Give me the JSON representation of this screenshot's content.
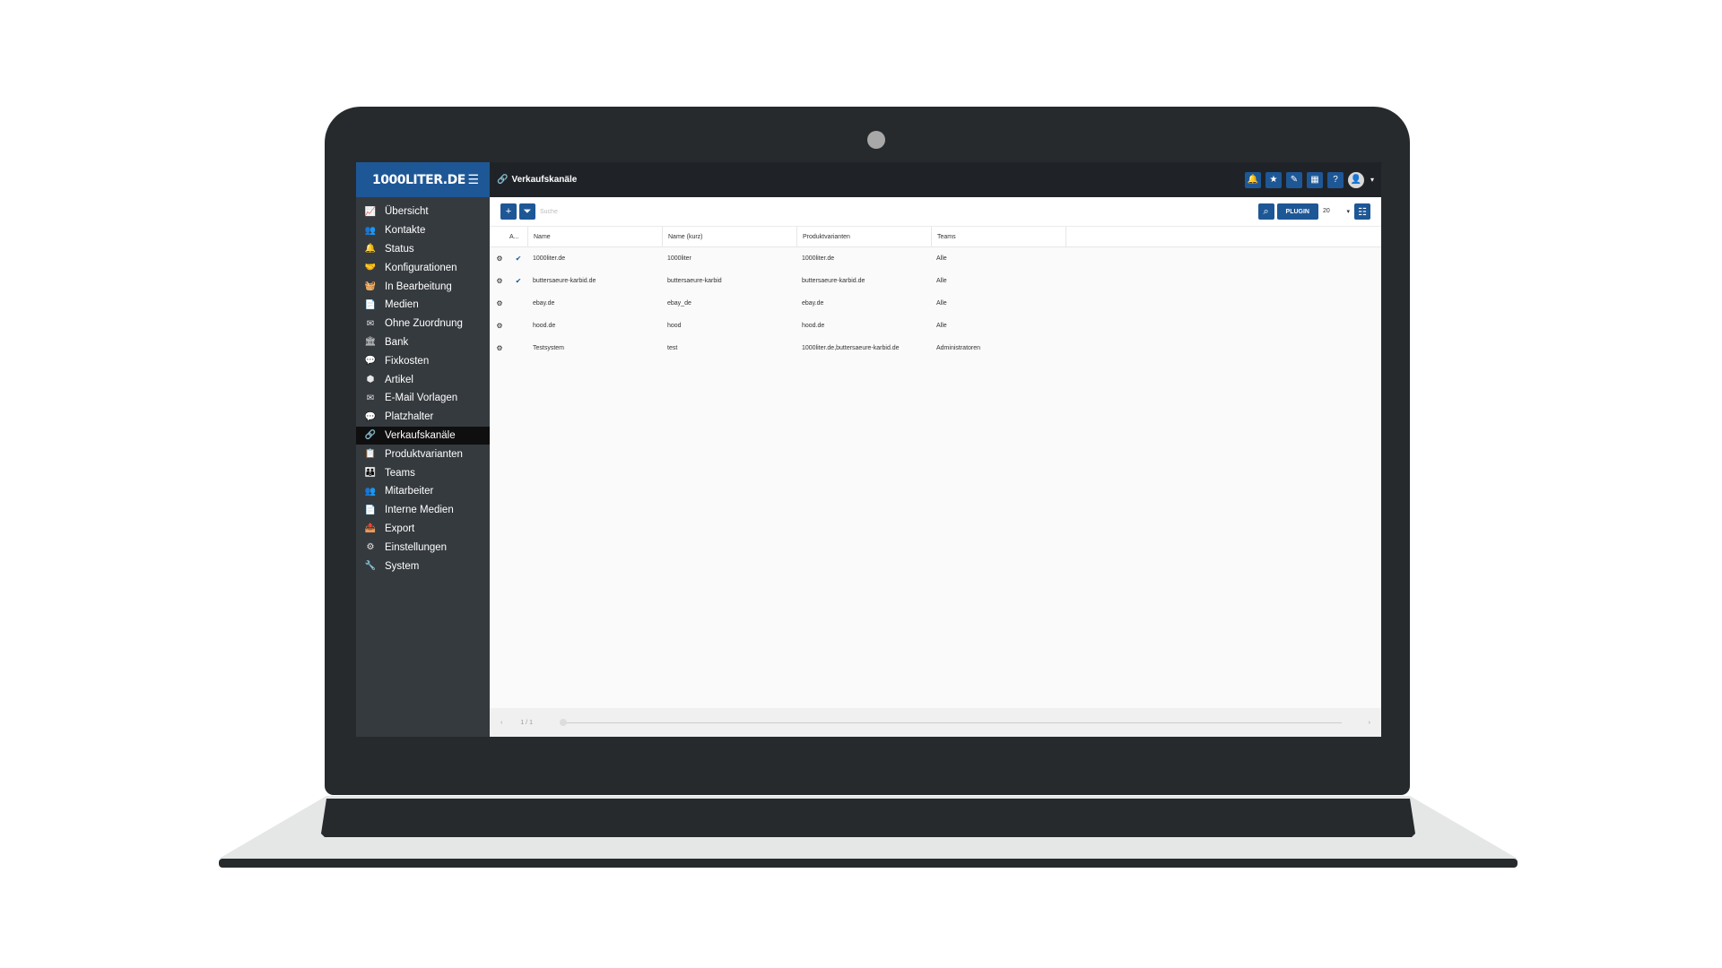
{
  "brand": {
    "name": "1000LITER.DE"
  },
  "header": {
    "title": "Verkaufskanäle"
  },
  "nav": [
    {
      "icon": "chart-line-icon",
      "glyph": "📈",
      "label": "Übersicht"
    },
    {
      "icon": "users-icon",
      "glyph": "👥",
      "label": "Kontakte"
    },
    {
      "icon": "bell-icon",
      "glyph": "🔔",
      "label": "Status"
    },
    {
      "icon": "handshake-icon",
      "glyph": "🤝",
      "label": "Konfigurationen"
    },
    {
      "icon": "basket-icon",
      "glyph": "🧺",
      "label": "In Bearbeitung"
    },
    {
      "icon": "file-icon",
      "glyph": "📄",
      "label": "Medien"
    },
    {
      "icon": "envelope-icon",
      "glyph": "✉",
      "label": "Ohne Zuordnung"
    },
    {
      "icon": "bank-icon",
      "glyph": "🏛",
      "label": "Bank"
    },
    {
      "icon": "comment-dollar-icon",
      "glyph": "💬",
      "label": "Fixkosten"
    },
    {
      "icon": "cube-icon",
      "glyph": "⬢",
      "label": "Artikel"
    },
    {
      "icon": "envelope-icon",
      "glyph": "✉",
      "label": "E-Mail Vorlagen"
    },
    {
      "icon": "comment-alt-icon",
      "glyph": "💬",
      "label": "Platzhalter"
    },
    {
      "icon": "link-icon",
      "glyph": "🔗",
      "label": "Verkaufskanäle",
      "active": true
    },
    {
      "icon": "clipboard-icon",
      "glyph": "📋",
      "label": "Produktvarianten"
    },
    {
      "icon": "team-icon",
      "glyph": "👪",
      "label": "Teams"
    },
    {
      "icon": "users-cog-icon",
      "glyph": "👥",
      "label": "Mitarbeiter"
    },
    {
      "icon": "file-icon",
      "glyph": "📄",
      "label": "Interne Medien"
    },
    {
      "icon": "file-export-icon",
      "glyph": "📤",
      "label": "Export"
    },
    {
      "icon": "cog-icon",
      "glyph": "⚙",
      "label": "Einstellungen"
    },
    {
      "icon": "wrench-icon",
      "glyph": "🔧",
      "label": "System"
    }
  ],
  "toolbar": {
    "search_placeholder": "Suche",
    "plugin_label": "PLUGIN",
    "page_size": "20"
  },
  "table": {
    "headers": {
      "a": "A...",
      "name": "Name",
      "short": "Name (kurz)",
      "prod": "Produktvarianten",
      "teams": "Teams"
    },
    "rows": [
      {
        "checked": true,
        "name": "1000liter.de",
        "short": "1000liter",
        "prod": "1000liter.de",
        "teams": "Alle"
      },
      {
        "checked": true,
        "name": "buttersaeure-karbid.de",
        "short": "buttersaeure-karbid",
        "prod": "buttersaeure-karbid.de",
        "teams": "Alle"
      },
      {
        "checked": false,
        "name": "ebay.de",
        "short": "ebay_de",
        "prod": "ebay.de",
        "teams": "Alle"
      },
      {
        "checked": false,
        "name": "hood.de",
        "short": "hood",
        "prod": "hood.de",
        "teams": "Alle"
      },
      {
        "checked": false,
        "name": "Testsystem",
        "short": "test",
        "prod": "1000liter.de,buttersaeure-karbid.de",
        "teams": "Administratoren"
      }
    ]
  },
  "footer": {
    "page": "1 / 1"
  },
  "colors": {
    "accent": "#1e5796",
    "sidebar": "#353a3f",
    "topbar": "#1f2327"
  }
}
